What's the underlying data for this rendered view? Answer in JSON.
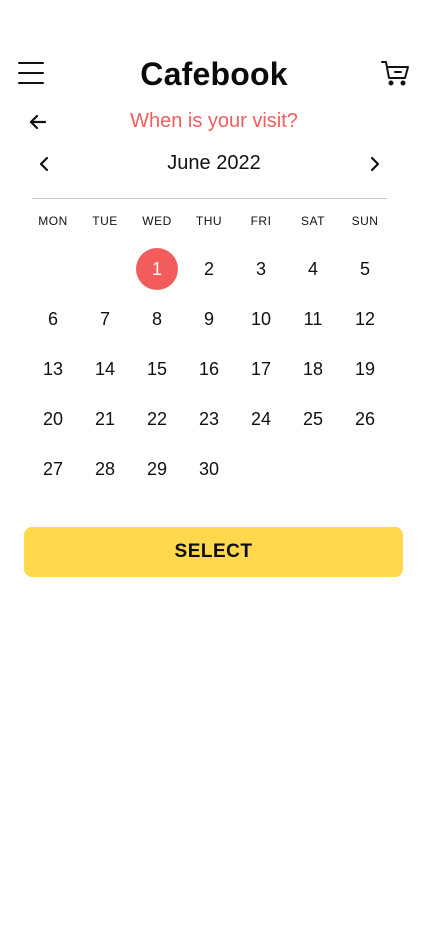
{
  "header": {
    "title": "Cafebook",
    "menu_icon": "hamburger-menu-icon",
    "cart_icon": "shopping-cart-icon"
  },
  "subheader": {
    "title": "When is your visit?",
    "back_icon": "arrow-left-icon"
  },
  "calendar": {
    "month_label": "June 2022",
    "prev_icon": "chevron-left-icon",
    "next_icon": "chevron-right-icon",
    "weekdays": [
      "MON",
      "TUE",
      "WED",
      "THU",
      "FRI",
      "SAT",
      "SUN"
    ],
    "leading_blanks": 2,
    "days": [
      "1",
      "2",
      "3",
      "4",
      "5",
      "6",
      "7",
      "8",
      "9",
      "10",
      "11",
      "12",
      "13",
      "14",
      "15",
      "16",
      "17",
      "18",
      "19",
      "20",
      "21",
      "22",
      "23",
      "24",
      "25",
      "26",
      "27",
      "28",
      "29",
      "30"
    ],
    "selected_day": "1"
  },
  "actions": {
    "select_label": "SELECT"
  },
  "colors": {
    "accent": "#f25c5c",
    "button": "#ffd84d",
    "text": "#111111",
    "divider": "#c7c7c7"
  }
}
